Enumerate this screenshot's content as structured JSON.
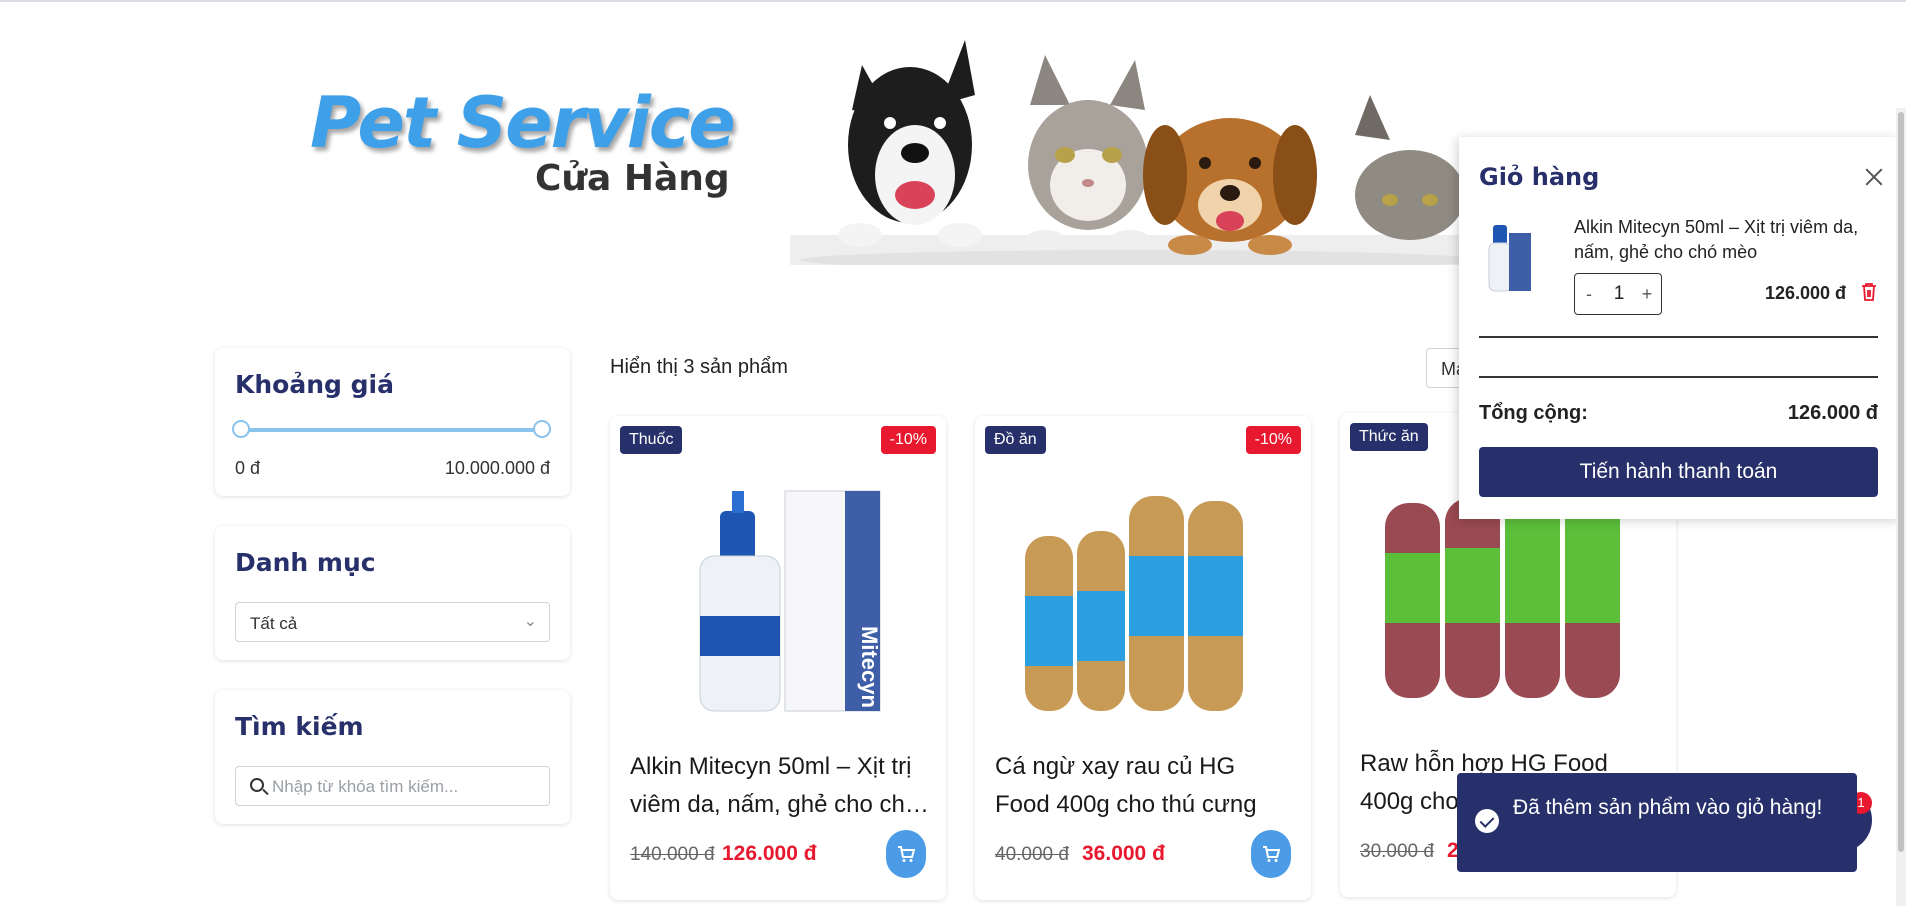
{
  "hero": {
    "brand_title": "Pet Service",
    "brand_subtitle": "Cửa Hàng"
  },
  "sidebar": {
    "price_filter": {
      "title": "Khoảng giá",
      "min_label": "0 đ",
      "max_label": "10.000.000 đ",
      "range_fraction": [
        0,
        1
      ]
    },
    "category_filter": {
      "title": "Danh mục",
      "selected": "Tất cả"
    },
    "search": {
      "title": "Tìm kiếm",
      "placeholder": "Nhập từ khóa tìm kiếm..."
    }
  },
  "listing": {
    "result_count": "Hiển thị 3 sản phẩm",
    "sort_visible": "Ma"
  },
  "products": [
    {
      "category": "Thuốc",
      "discount": "-10%",
      "name": "Alkin Mitecyn 50ml – Xịt trị viêm da, nấm, ghẻ cho chó mèo",
      "old_price": "140.000 đ",
      "price": "126.000 đ"
    },
    {
      "category": "Đồ ăn",
      "discount": "-10%",
      "name": "Cá ngừ xay rau củ HG Food 400g cho thú cưng",
      "old_price": "40.000 đ",
      "price": "36.000 đ"
    },
    {
      "category": "Thức ăn",
      "discount": "",
      "name": "Raw hỗn hợp HG Food 400g cho chó mèo",
      "old_price": "30.000 đ",
      "price": "2"
    }
  ],
  "cart": {
    "title": "Giỏ hàng",
    "item": {
      "name": "Alkin Mitecyn 50ml – Xịt trị viêm da, nấm, ghẻ cho chó mèo",
      "quantity": "1",
      "minus": "-",
      "plus": "+",
      "price": "126.000 đ"
    },
    "total_label": "Tổng cộng:",
    "total_value": "126.000 đ",
    "checkout_label": "Tiến hành thanh toán"
  },
  "toast": {
    "message": "Đã thêm sản phẩm vào giỏ hàng!",
    "cart_count": "1"
  },
  "colors": {
    "navy": "#27306b",
    "accent_blue": "#3ea0e8",
    "sale_red": "#e8182e"
  }
}
